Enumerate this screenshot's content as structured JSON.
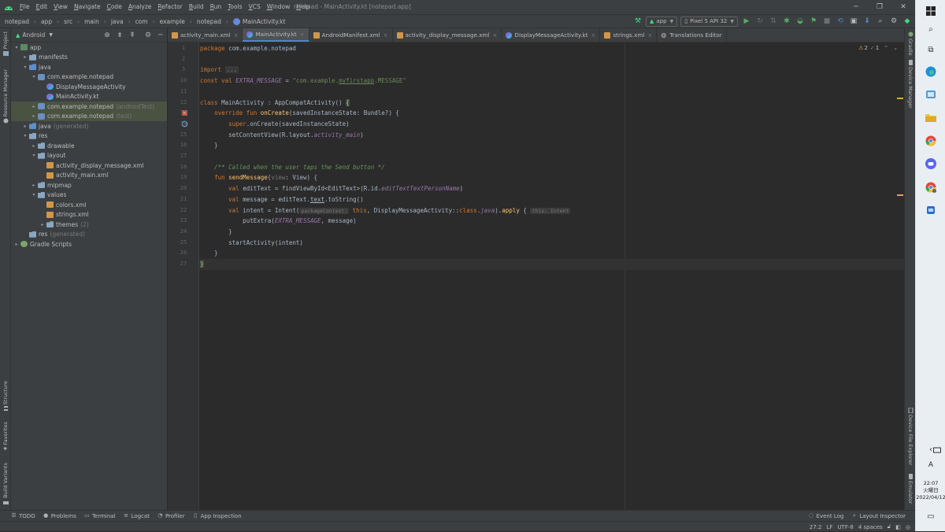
{
  "menu": [
    "File",
    "Edit",
    "View",
    "Navigate",
    "Code",
    "Analyze",
    "Refactor",
    "Build",
    "Run",
    "Tools",
    "VCS",
    "Window",
    "Help"
  ],
  "window_title": "notepad - MainActivity.kt [notepad.app]",
  "breadcrumb": [
    "notepad",
    "app",
    "src",
    "main",
    "java",
    "com",
    "example",
    "notepad",
    "MainActivity.kt"
  ],
  "run_config": "app",
  "device": "Pixel 5 API 32",
  "project_view": "Android",
  "tree": [
    {
      "depth": 0,
      "arrow": "▾",
      "icon": "mod",
      "label": "app",
      "note": ""
    },
    {
      "depth": 1,
      "arrow": "▸",
      "icon": "folder",
      "label": "manifests",
      "note": ""
    },
    {
      "depth": 1,
      "arrow": "▾",
      "icon": "folderj",
      "label": "java",
      "note": ""
    },
    {
      "depth": 2,
      "arrow": "▾",
      "icon": "pkg",
      "label": "com.example.notepad",
      "note": ""
    },
    {
      "depth": 3,
      "arrow": "",
      "icon": "kt",
      "label": "DisplayMessageActivity",
      "note": ""
    },
    {
      "depth": 3,
      "arrow": "",
      "icon": "kt",
      "label": "MainActivity.kt",
      "note": ""
    },
    {
      "depth": 2,
      "arrow": "▸",
      "icon": "pkg",
      "label": "com.example.notepad",
      "note": "(androidTest)",
      "hl": true
    },
    {
      "depth": 2,
      "arrow": "▸",
      "icon": "pkg",
      "label": "com.example.notepad",
      "note": "(test)",
      "hl": true
    },
    {
      "depth": 1,
      "arrow": "▸",
      "icon": "folderj",
      "label": "java",
      "note": "(generated)"
    },
    {
      "depth": 1,
      "arrow": "▾",
      "icon": "folder",
      "label": "res",
      "note": ""
    },
    {
      "depth": 2,
      "arrow": "▸",
      "icon": "folder",
      "label": "drawable",
      "note": ""
    },
    {
      "depth": 2,
      "arrow": "▾",
      "icon": "folder",
      "label": "layout",
      "note": ""
    },
    {
      "depth": 3,
      "arrow": "",
      "icon": "xml",
      "label": "activity_display_message.xml",
      "note": ""
    },
    {
      "depth": 3,
      "arrow": "",
      "icon": "xml",
      "label": "activity_main.xml",
      "note": ""
    },
    {
      "depth": 2,
      "arrow": "▸",
      "icon": "folder",
      "label": "mipmap",
      "note": ""
    },
    {
      "depth": 2,
      "arrow": "▾",
      "icon": "folder",
      "label": "values",
      "note": ""
    },
    {
      "depth": 3,
      "arrow": "",
      "icon": "xml",
      "label": "colors.xml",
      "note": ""
    },
    {
      "depth": 3,
      "arrow": "",
      "icon": "xml",
      "label": "strings.xml",
      "note": ""
    },
    {
      "depth": 3,
      "arrow": "▸",
      "icon": "folder",
      "label": "themes",
      "note": "(2)"
    },
    {
      "depth": 1,
      "arrow": "",
      "icon": "folder",
      "label": "res",
      "note": "(generated)"
    },
    {
      "depth": 0,
      "arrow": "▸",
      "icon": "grad",
      "label": "Gradle Scripts",
      "note": ""
    }
  ],
  "tabs": [
    {
      "label": "activity_main.xml",
      "icon": "xml",
      "active": false
    },
    {
      "label": "MainActivity.kt",
      "icon": "kt",
      "active": true
    },
    {
      "label": "AndroidManifest.xml",
      "icon": "xml",
      "active": false
    },
    {
      "label": "activity_display_message.xml",
      "icon": "xml",
      "active": false
    },
    {
      "label": "DisplayMessageActivity.kt",
      "icon": "kt",
      "active": false
    },
    {
      "label": "strings.xml",
      "icon": "xml",
      "active": false
    },
    {
      "label": "Translations Editor",
      "icon": "globe",
      "active": false
    }
  ],
  "inspection": {
    "warnings": "2",
    "ok": "1"
  },
  "code": [
    {
      "ln": "1",
      "t": [
        [
          "k",
          "package "
        ],
        [
          "n",
          "com.example.notepad"
        ]
      ]
    },
    {
      "ln": "2",
      "t": []
    },
    {
      "ln": "3",
      "t": [
        [
          "k",
          "import "
        ],
        [
          "fold",
          "..."
        ]
      ]
    },
    {
      "ln": "10",
      "t": []
    },
    {
      "ln": "10",
      "t": [
        [
          "k",
          "const val "
        ],
        [
          "p",
          "EXTRA_MESSAGE"
        ],
        [
          "n",
          " = "
        ],
        [
          "s",
          "\"com.example."
        ],
        [
          "sl",
          "myfirstapp"
        ],
        [
          "s",
          ".MESSAGE\""
        ]
      ]
    },
    {
      "ln": "11",
      "t": []
    },
    {
      "ln": "12",
      "t": [
        [
          "k",
          "class "
        ],
        [
          "n",
          "MainActivity : AppCompatActivity() "
        ],
        [
          "brc",
          "{"
        ]
      ]
    },
    {
      "ln": "13",
      "t": [
        [
          "n",
          "    "
        ],
        [
          "k",
          "override fun "
        ],
        [
          "f",
          "onCreate"
        ],
        [
          "n",
          "(savedInstanceState: Bundle?) {"
        ]
      ]
    },
    {
      "ln": "14",
      "t": [
        [
          "n",
          "        "
        ],
        [
          "k",
          "super"
        ],
        [
          "n",
          ".onCreate(savedInstanceState)"
        ]
      ]
    },
    {
      "ln": "15",
      "t": [
        [
          "n",
          "        setContentView(R.layout."
        ],
        [
          "ct",
          "activity_main"
        ],
        [
          "n",
          ")"
        ]
      ]
    },
    {
      "ln": "16",
      "t": [
        [
          "n",
          "    }"
        ]
      ]
    },
    {
      "ln": "17",
      "t": []
    },
    {
      "ln": "18",
      "t": [
        [
          "c",
          "    /** Called when the user taps the Send button */"
        ]
      ]
    },
    {
      "ln": "19",
      "t": [
        [
          "n",
          "    "
        ],
        [
          "k",
          "fun "
        ],
        [
          "f",
          "sendMessage"
        ],
        [
          "n",
          "("
        ],
        [
          "gray",
          "view"
        ],
        [
          "n",
          ": View) {"
        ]
      ]
    },
    {
      "ln": "20",
      "t": [
        [
          "n",
          "        "
        ],
        [
          "k",
          "val "
        ],
        [
          "n",
          "editText = findViewById<EditText>(R.id."
        ],
        [
          "ct",
          "editTextTextPersonName"
        ],
        [
          "n",
          ")"
        ]
      ]
    },
    {
      "ln": "21",
      "t": [
        [
          "n",
          "        "
        ],
        [
          "k",
          "val "
        ],
        [
          "n",
          "message = editText."
        ],
        [
          "link",
          "text"
        ],
        [
          "n",
          ".toString()"
        ]
      ]
    },
    {
      "ln": "22",
      "t": [
        [
          "n",
          "        "
        ],
        [
          "k",
          "val "
        ],
        [
          "n",
          "intent = Intent("
        ],
        [
          "hint",
          "packageContext:"
        ],
        [
          "n",
          " "
        ],
        [
          "k",
          "this"
        ],
        [
          "n",
          ", DisplayMessageActivity::"
        ],
        [
          "k",
          "class"
        ],
        [
          "n",
          "."
        ],
        [
          "ct",
          "java"
        ],
        [
          "n",
          ")."
        ],
        [
          "f",
          "apply"
        ],
        [
          "n",
          " { "
        ],
        [
          "hint",
          "this: Intent"
        ]
      ]
    },
    {
      "ln": "23",
      "t": [
        [
          "n",
          "            putExtra("
        ],
        [
          "p",
          "EXTRA_MESSAGE"
        ],
        [
          "n",
          ", message)"
        ]
      ]
    },
    {
      "ln": "24",
      "t": [
        [
          "n",
          "        }"
        ]
      ]
    },
    {
      "ln": "25",
      "t": [
        [
          "n",
          "        startActivity(intent)"
        ]
      ]
    },
    {
      "ln": "26",
      "t": [
        [
          "n",
          "    }"
        ]
      ]
    },
    {
      "ln": "27",
      "t": [
        [
          "brc",
          "}"
        ]
      ],
      "cur": true
    }
  ],
  "left_tools_top": [
    "Project",
    "Resource Manager"
  ],
  "left_tools_bottom": [
    "Structure",
    "Favorites",
    "Build Variants"
  ],
  "right_tools_top": [
    "Gradle",
    "Device Manager"
  ],
  "right_tools_bottom": [
    "Device File Explorer",
    "Emulator"
  ],
  "bottom_tools": [
    {
      "label": "TODO",
      "icon": "list-icon",
      "glyph": "☰"
    },
    {
      "label": "Problems",
      "icon": "problems-icon",
      "glyph": "●"
    },
    {
      "label": "Terminal",
      "icon": "terminal-icon",
      "glyph": "▭"
    },
    {
      "label": "Logcat",
      "icon": "logcat-icon",
      "glyph": "≡"
    },
    {
      "label": "Profiler",
      "icon": "profiler-icon",
      "glyph": "◔"
    },
    {
      "label": "App Inspection",
      "icon": "app-inspection-icon",
      "glyph": "▯"
    }
  ],
  "bottom_tools_right": [
    {
      "label": "Event Log",
      "icon": "event-log-icon",
      "glyph": "◌"
    },
    {
      "label": "Layout Inspector",
      "icon": "layout-inspector-icon",
      "glyph": "⌕"
    }
  ],
  "status": {
    "position": "27:2",
    "line_sep": "LF",
    "encoding": "UTF-8",
    "indent": "4 spaces"
  },
  "clock": {
    "time": "22:07",
    "day": "火曜日",
    "date": "2022/04/12"
  },
  "ime": "A"
}
